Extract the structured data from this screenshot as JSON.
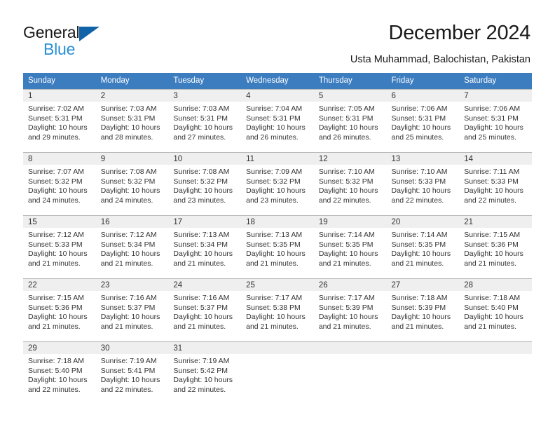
{
  "brand": {
    "name_part1": "General",
    "name_part2": "Blue",
    "color_dark": "#1b1b1b",
    "color_blue": "#2a8fd4",
    "triangle_color": "#1163a8"
  },
  "header": {
    "title": "December 2024",
    "subtitle": "Usta Muhammad, Balochistan, Pakistan"
  },
  "calendar": {
    "header_bg": "#3c7dc0",
    "daynum_bg": "#efefef",
    "weekdays": [
      "Sunday",
      "Monday",
      "Tuesday",
      "Wednesday",
      "Thursday",
      "Friday",
      "Saturday"
    ],
    "weeks": [
      [
        {
          "day": "1",
          "sunrise": "Sunrise: 7:02 AM",
          "sunset": "Sunset: 5:31 PM",
          "daylight": "Daylight: 10 hours and 29 minutes."
        },
        {
          "day": "2",
          "sunrise": "Sunrise: 7:03 AM",
          "sunset": "Sunset: 5:31 PM",
          "daylight": "Daylight: 10 hours and 28 minutes."
        },
        {
          "day": "3",
          "sunrise": "Sunrise: 7:03 AM",
          "sunset": "Sunset: 5:31 PM",
          "daylight": "Daylight: 10 hours and 27 minutes."
        },
        {
          "day": "4",
          "sunrise": "Sunrise: 7:04 AM",
          "sunset": "Sunset: 5:31 PM",
          "daylight": "Daylight: 10 hours and 26 minutes."
        },
        {
          "day": "5",
          "sunrise": "Sunrise: 7:05 AM",
          "sunset": "Sunset: 5:31 PM",
          "daylight": "Daylight: 10 hours and 26 minutes."
        },
        {
          "day": "6",
          "sunrise": "Sunrise: 7:06 AM",
          "sunset": "Sunset: 5:31 PM",
          "daylight": "Daylight: 10 hours and 25 minutes."
        },
        {
          "day": "7",
          "sunrise": "Sunrise: 7:06 AM",
          "sunset": "Sunset: 5:31 PM",
          "daylight": "Daylight: 10 hours and 25 minutes."
        }
      ],
      [
        {
          "day": "8",
          "sunrise": "Sunrise: 7:07 AM",
          "sunset": "Sunset: 5:32 PM",
          "daylight": "Daylight: 10 hours and 24 minutes."
        },
        {
          "day": "9",
          "sunrise": "Sunrise: 7:08 AM",
          "sunset": "Sunset: 5:32 PM",
          "daylight": "Daylight: 10 hours and 24 minutes."
        },
        {
          "day": "10",
          "sunrise": "Sunrise: 7:08 AM",
          "sunset": "Sunset: 5:32 PM",
          "daylight": "Daylight: 10 hours and 23 minutes."
        },
        {
          "day": "11",
          "sunrise": "Sunrise: 7:09 AM",
          "sunset": "Sunset: 5:32 PM",
          "daylight": "Daylight: 10 hours and 23 minutes."
        },
        {
          "day": "12",
          "sunrise": "Sunrise: 7:10 AM",
          "sunset": "Sunset: 5:32 PM",
          "daylight": "Daylight: 10 hours and 22 minutes."
        },
        {
          "day": "13",
          "sunrise": "Sunrise: 7:10 AM",
          "sunset": "Sunset: 5:33 PM",
          "daylight": "Daylight: 10 hours and 22 minutes."
        },
        {
          "day": "14",
          "sunrise": "Sunrise: 7:11 AM",
          "sunset": "Sunset: 5:33 PM",
          "daylight": "Daylight: 10 hours and 22 minutes."
        }
      ],
      [
        {
          "day": "15",
          "sunrise": "Sunrise: 7:12 AM",
          "sunset": "Sunset: 5:33 PM",
          "daylight": "Daylight: 10 hours and 21 minutes."
        },
        {
          "day": "16",
          "sunrise": "Sunrise: 7:12 AM",
          "sunset": "Sunset: 5:34 PM",
          "daylight": "Daylight: 10 hours and 21 minutes."
        },
        {
          "day": "17",
          "sunrise": "Sunrise: 7:13 AM",
          "sunset": "Sunset: 5:34 PM",
          "daylight": "Daylight: 10 hours and 21 minutes."
        },
        {
          "day": "18",
          "sunrise": "Sunrise: 7:13 AM",
          "sunset": "Sunset: 5:35 PM",
          "daylight": "Daylight: 10 hours and 21 minutes."
        },
        {
          "day": "19",
          "sunrise": "Sunrise: 7:14 AM",
          "sunset": "Sunset: 5:35 PM",
          "daylight": "Daylight: 10 hours and 21 minutes."
        },
        {
          "day": "20",
          "sunrise": "Sunrise: 7:14 AM",
          "sunset": "Sunset: 5:35 PM",
          "daylight": "Daylight: 10 hours and 21 minutes."
        },
        {
          "day": "21",
          "sunrise": "Sunrise: 7:15 AM",
          "sunset": "Sunset: 5:36 PM",
          "daylight": "Daylight: 10 hours and 21 minutes."
        }
      ],
      [
        {
          "day": "22",
          "sunrise": "Sunrise: 7:15 AM",
          "sunset": "Sunset: 5:36 PM",
          "daylight": "Daylight: 10 hours and 21 minutes."
        },
        {
          "day": "23",
          "sunrise": "Sunrise: 7:16 AM",
          "sunset": "Sunset: 5:37 PM",
          "daylight": "Daylight: 10 hours and 21 minutes."
        },
        {
          "day": "24",
          "sunrise": "Sunrise: 7:16 AM",
          "sunset": "Sunset: 5:37 PM",
          "daylight": "Daylight: 10 hours and 21 minutes."
        },
        {
          "day": "25",
          "sunrise": "Sunrise: 7:17 AM",
          "sunset": "Sunset: 5:38 PM",
          "daylight": "Daylight: 10 hours and 21 minutes."
        },
        {
          "day": "26",
          "sunrise": "Sunrise: 7:17 AM",
          "sunset": "Sunset: 5:39 PM",
          "daylight": "Daylight: 10 hours and 21 minutes."
        },
        {
          "day": "27",
          "sunrise": "Sunrise: 7:18 AM",
          "sunset": "Sunset: 5:39 PM",
          "daylight": "Daylight: 10 hours and 21 minutes."
        },
        {
          "day": "28",
          "sunrise": "Sunrise: 7:18 AM",
          "sunset": "Sunset: 5:40 PM",
          "daylight": "Daylight: 10 hours and 21 minutes."
        }
      ],
      [
        {
          "day": "29",
          "sunrise": "Sunrise: 7:18 AM",
          "sunset": "Sunset: 5:40 PM",
          "daylight": "Daylight: 10 hours and 22 minutes."
        },
        {
          "day": "30",
          "sunrise": "Sunrise: 7:19 AM",
          "sunset": "Sunset: 5:41 PM",
          "daylight": "Daylight: 10 hours and 22 minutes."
        },
        {
          "day": "31",
          "sunrise": "Sunrise: 7:19 AM",
          "sunset": "Sunset: 5:42 PM",
          "daylight": "Daylight: 10 hours and 22 minutes."
        },
        {
          "day": "",
          "sunrise": "",
          "sunset": "",
          "daylight": ""
        },
        {
          "day": "",
          "sunrise": "",
          "sunset": "",
          "daylight": ""
        },
        {
          "day": "",
          "sunrise": "",
          "sunset": "",
          "daylight": ""
        },
        {
          "day": "",
          "sunrise": "",
          "sunset": "",
          "daylight": ""
        }
      ]
    ]
  }
}
